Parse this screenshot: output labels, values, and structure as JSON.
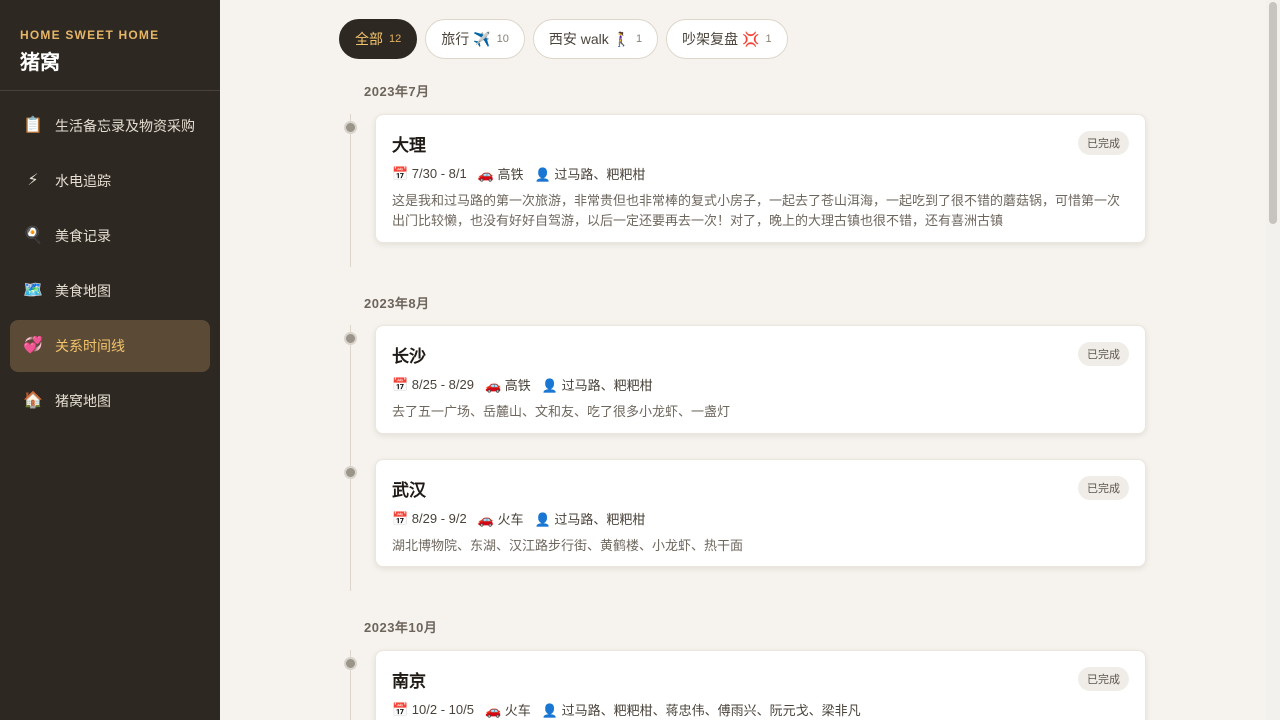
{
  "sidebar": {
    "brand_sub": "HOME SWEET HOME",
    "brand_title": "猪窝",
    "items": [
      {
        "icon": "📋",
        "icon_name": "clipboard-icon",
        "label": "生活备忘录及物资采购"
      },
      {
        "icon": "⚡",
        "icon_name": "lightning-icon",
        "label": "水电追踪"
      },
      {
        "icon": "🍳",
        "icon_name": "frying-pan-icon",
        "label": "美食记录"
      },
      {
        "icon": "🗺️",
        "icon_name": "map-icon",
        "label": "美食地图"
      },
      {
        "icon": "💞",
        "icon_name": "hearts-icon",
        "label": "关系时间线",
        "active": true
      },
      {
        "icon": "🏠",
        "icon_name": "house-icon",
        "label": "猪窝地图"
      }
    ]
  },
  "filters": [
    {
      "label": "全部",
      "count": "12",
      "active": true
    },
    {
      "label": "旅行 ✈️",
      "count": "10"
    },
    {
      "label": "西安 walk 🚶‍♀️",
      "count": "1"
    },
    {
      "label": "吵架复盘 💢",
      "count": "1"
    }
  ],
  "timeline": {
    "months": [
      "2023年7月",
      "2023年8月",
      "2023年10月"
    ],
    "entries": [
      {
        "title": "大理",
        "status": "已完成",
        "date": "📅 7/30 - 8/1",
        "transport": "🚗 高铁",
        "people": "👤 过马路、粑粑柑",
        "desc": "这是我和过马路的第一次旅游，非常贵但也非常棒的复式小房子，一起去了苍山洱海，一起吃到了很不错的蘑菇锅，可惜第一次出门比较懒，也没有好好自驾游，以后一定还要再去一次！对了，晚上的大理古镇也很不错，还有喜洲古镇"
      },
      {
        "title": "长沙",
        "status": "已完成",
        "date": "📅 8/25 - 8/29",
        "transport": "🚗 高铁",
        "people": "👤 过马路、粑粑柑",
        "desc": "去了五一广场、岳麓山、文和友、吃了很多小龙虾、一盏灯"
      },
      {
        "title": "武汉",
        "status": "已完成",
        "date": "📅 8/29 - 9/2",
        "transport": "🚗 火车",
        "people": "👤 过马路、粑粑柑",
        "desc": "湖北博物院、东湖、汉江路步行街、黄鹤楼、小龙虾、热干面"
      },
      {
        "title": "南京",
        "status": "已完成",
        "date": "📅 10/2 - 10/5",
        "transport": "🚗 火车",
        "people": "👤 过马路、粑粑柑、蒋忠伟、傅雨兴、阮元戈、梁非凡",
        "desc": ""
      }
    ]
  },
  "colors": {
    "sidebar_bg": "#2e2822",
    "accent": "#f2c36b",
    "page_bg": "#f6f3ee"
  }
}
